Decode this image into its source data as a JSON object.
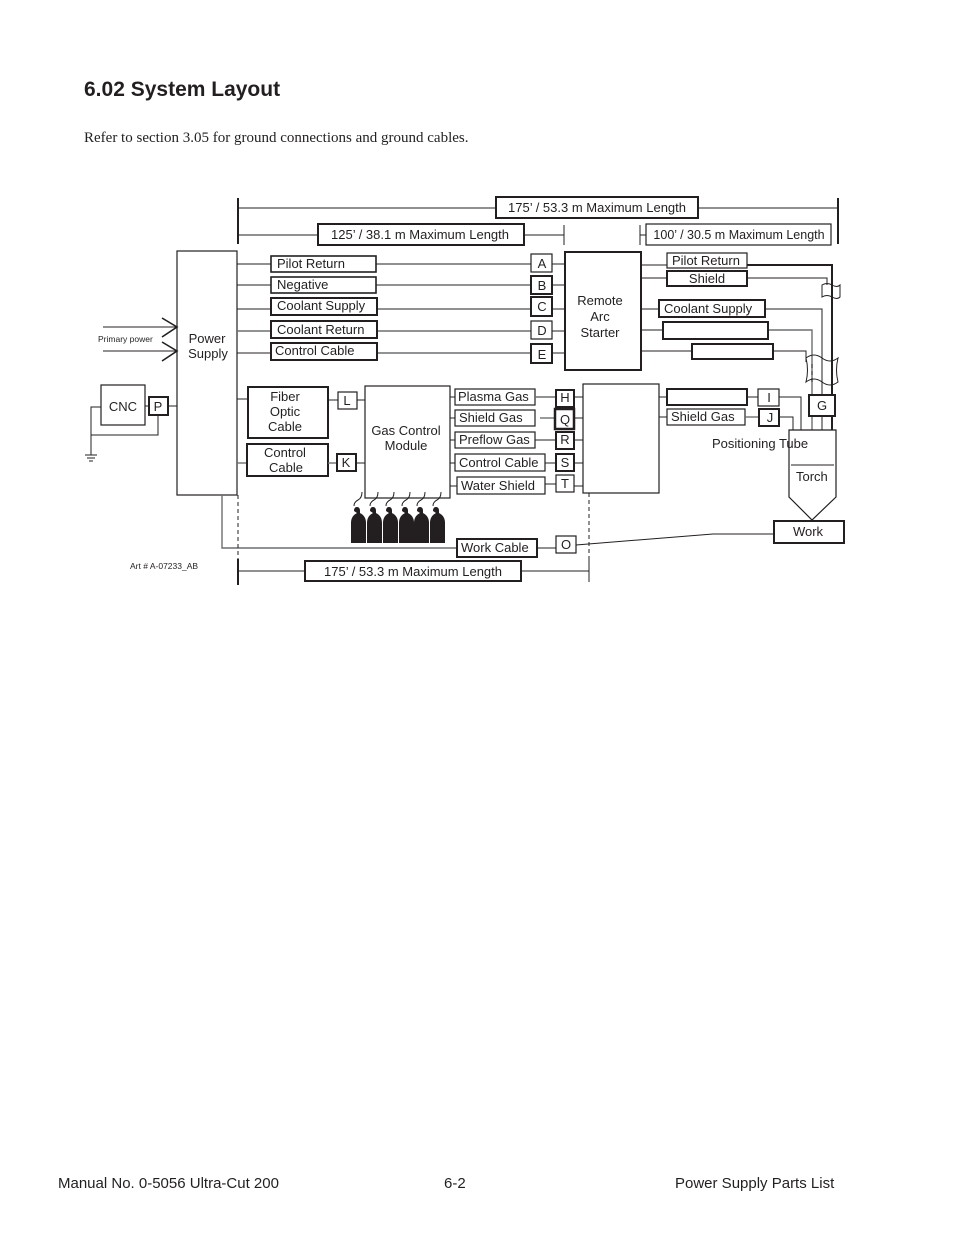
{
  "page": {
    "section_title": "6.02  System Layout",
    "intro_text": "Refer to section 3.05 for ground connections and ground cables."
  },
  "diagram": {
    "dimensions": {
      "top_overall": "175’ / 53.3 m  Maximum Length",
      "ps_to_ras": "125’ / 38.1 m   Maximum Length",
      "ras_to_torch": "100’ / 30.5 m Maximum Length",
      "bottom_overall": "175’ /  53.3 m Maximum Length"
    },
    "components": {
      "power_supply": [
        "Power",
        "Supply"
      ],
      "remote_arc_starter": [
        "Remote",
        "Arc",
        "Starter"
      ],
      "gas_control_module": [
        "Gas Control",
        "Module"
      ],
      "cnc": "CNC",
      "fiber_optic_cable": [
        "Fiber",
        "Optic",
        "Cable"
      ],
      "control_cable_gcm": [
        "Control",
        "Cable"
      ],
      "positioning_tube": "Positioning Tube",
      "torch": "Torch",
      "work": "Work",
      "primary_power": "Primary power",
      "art_number": "Art # A-07233_AB"
    },
    "ps_to_ras_cables": [
      {
        "label": "Pilot Return",
        "connector": "A"
      },
      {
        "label": "Negative",
        "connector": "B"
      },
      {
        "label": "Coolant Supply",
        "connector": "C"
      },
      {
        "label": "Coolant Return",
        "connector": "D"
      },
      {
        "label": "Control Cable",
        "connector": "E"
      }
    ],
    "ras_to_torch_cables": [
      {
        "label": "Pilot Return"
      },
      {
        "label": "Shield"
      },
      {
        "label": "Coolant Supply"
      },
      {
        "label": ""
      },
      {
        "label": ""
      }
    ],
    "gcm_cables": [
      {
        "label": "Plasma Gas",
        "connector": "H"
      },
      {
        "label": "Shield Gas",
        "connector": "Q"
      },
      {
        "label": "Preflow Gas",
        "connector": "R"
      },
      {
        "label": "Control Cable",
        "connector": "S"
      },
      {
        "label": "Water Shield",
        "connector": "T"
      }
    ],
    "torch_gas_cables": [
      {
        "label": "",
        "connector": "I"
      },
      {
        "label": "Shield Gas",
        "connector": "J"
      }
    ],
    "other_connectors": {
      "cnc": "P",
      "fiber": "L",
      "control": "K",
      "torch_lead": "G",
      "work": "O"
    },
    "work_cable": "Work Cable"
  },
  "footer": {
    "manual": "Manual No. 0-5056 Ultra-Cut 200",
    "page_number": "6-2",
    "section": "Power Supply Parts List"
  }
}
